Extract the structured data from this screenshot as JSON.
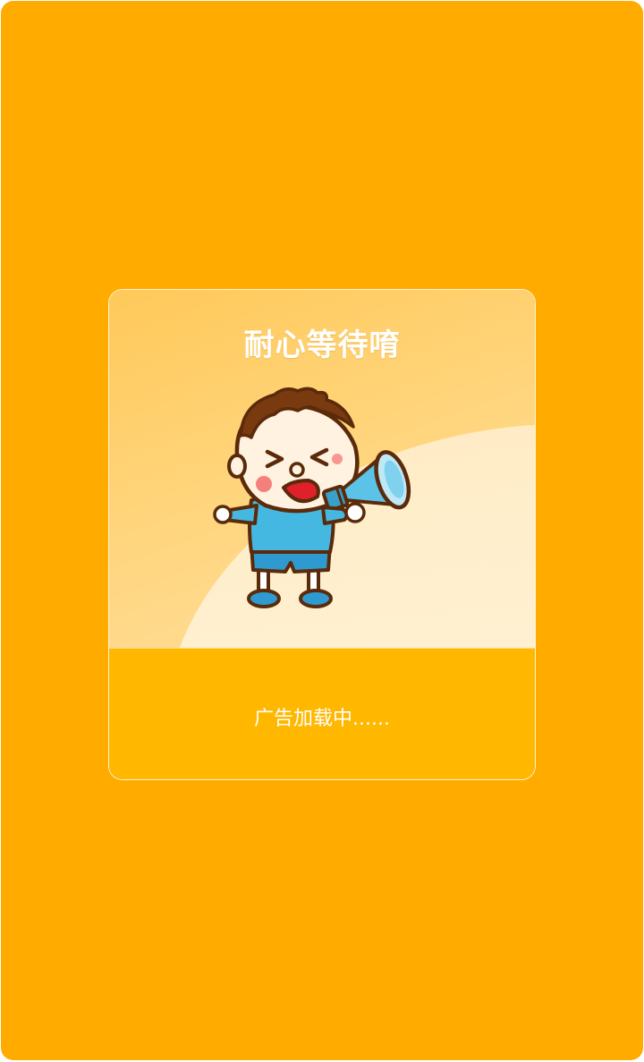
{
  "dialog": {
    "title": "耐心等待唷",
    "loading_text": "广告加载中......",
    "illustration": "boy-with-megaphone-icon"
  },
  "colors": {
    "background": "#FFAB00",
    "dialog_top": "#FFD47A",
    "dialog_bottom": "#FFB700",
    "text": "#FFFFFF"
  }
}
